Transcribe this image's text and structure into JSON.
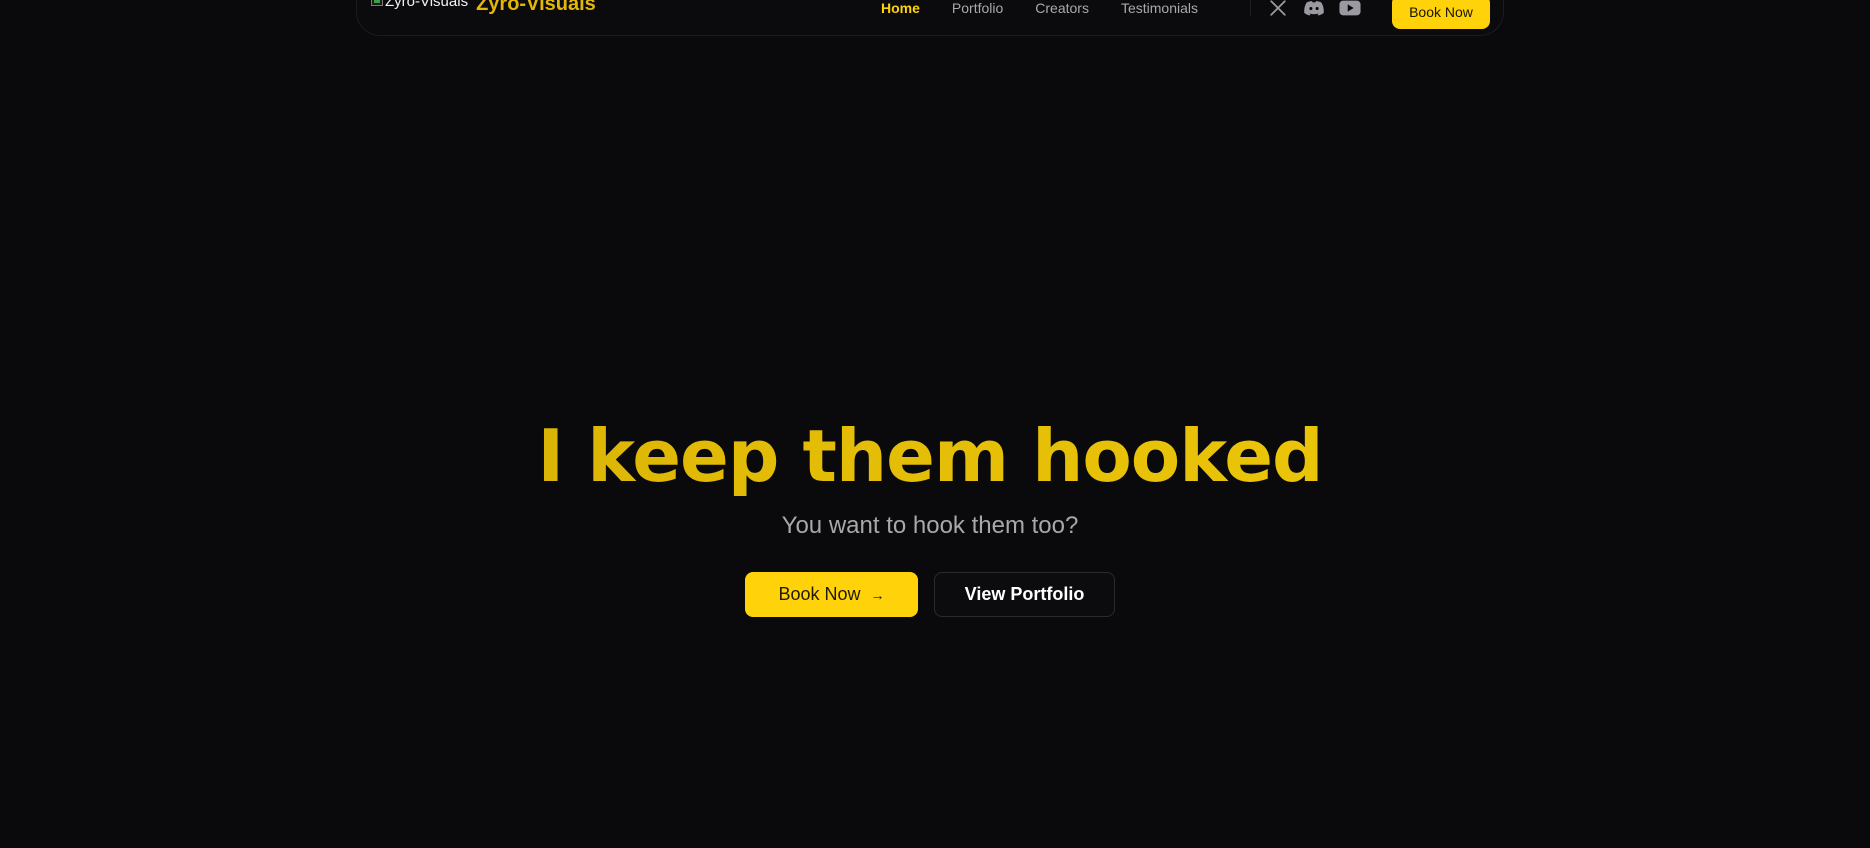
{
  "header": {
    "logo_alt": "Zyro-Visuals",
    "brand_name": "Zyro-Visuals",
    "nav": [
      {
        "label": "Home",
        "active": true
      },
      {
        "label": "Portfolio",
        "active": false
      },
      {
        "label": "Creators",
        "active": false
      },
      {
        "label": "Testimonials",
        "active": false
      }
    ],
    "socials": [
      "x-icon",
      "discord-icon",
      "youtube-icon"
    ],
    "cta_label": "Book Now"
  },
  "hero": {
    "title": "I keep them hooked",
    "subtitle": "You want to hook them too?",
    "primary_cta": "Book Now",
    "primary_cta_icon": "→",
    "secondary_cta": "View Portfolio"
  },
  "colors": {
    "background": "#0a0a0c",
    "accent": "#ffd20a",
    "muted_text": "#a7a7ac"
  }
}
